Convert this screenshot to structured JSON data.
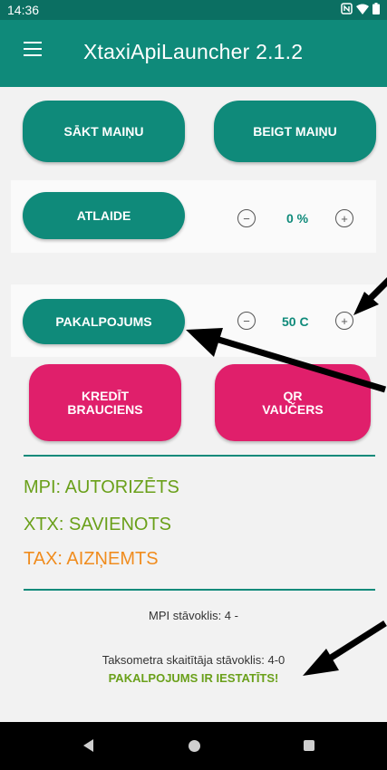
{
  "status_bar": {
    "time": "14:36",
    "icons": [
      "nfc-icon",
      "wifi-icon",
      "battery-icon"
    ]
  },
  "app_bar": {
    "title": "XtaxiApiLauncher 2.1.2"
  },
  "buttons": {
    "start_shift": "SĀKT MAIŅU",
    "end_shift": "BEIGT MAIŅU",
    "discount": "ATLAIDE",
    "service": "PAKALPOJUMS",
    "credit_ride_line1": "KREDĪT",
    "credit_ride_line2": "BRAUCIENS",
    "qr_voucher_line1": "QR",
    "qr_voucher_line2": "VAUČERS"
  },
  "discount": {
    "value": "0 %",
    "minus": "−",
    "plus": "+"
  },
  "service": {
    "value": "50 C",
    "minus": "−",
    "plus": "+"
  },
  "statuses": {
    "mpi": "MPI: AUTORIZĒTS",
    "xtx": "XTX: SAVIENOTS",
    "tax": "TAX: AIZŅEMTS"
  },
  "colors": {
    "primary": "#0f8a7a",
    "accent": "#e01f6b",
    "ok_green": "#6aa01a",
    "busy_orange": "#f08c1e"
  },
  "info": {
    "mpi_state": "MPI stāvoklis: 4 -",
    "meter_state": "Taksometra skaitītāja stāvoklis: 4-0",
    "service_set": "PAKALPOJUMS IR IESTATĪTS!"
  }
}
